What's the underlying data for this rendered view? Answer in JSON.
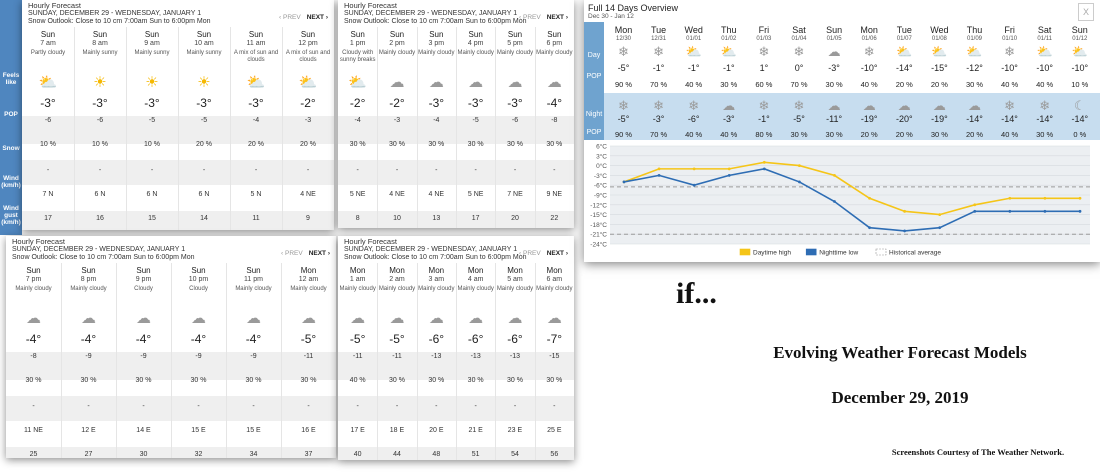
{
  "panels": [
    {
      "title": "Hourly Forecast",
      "dates": "SUNDAY, DECEMBER 29 - WEDNESDAY, JANUARY 1",
      "outlook": "Snow Outlook: Close to 10 cm 7:00am Sun to 6:00pm Mon",
      "prev": "‹ PREV",
      "next": "NEXT ›",
      "row_labels": {
        "feels": "Feels like",
        "pop": "POP",
        "snow": "Snow",
        "wind": "Wind (km/h)",
        "gust": "Wind gust (km/h)"
      },
      "hours": [
        {
          "day": "Sun",
          "hour": "7 am",
          "cond": "Partly cloudy",
          "icon": "partly-cloudy-icon",
          "temp": "-3°",
          "feels": "-6",
          "pop": "10 %",
          "snow": "-",
          "wind": "7 N",
          "gust": "17"
        },
        {
          "day": "Sun",
          "hour": "8 am",
          "cond": "Mainly sunny",
          "icon": "sun-icon",
          "temp": "-3°",
          "feels": "-6",
          "pop": "10 %",
          "snow": "-",
          "wind": "6 N",
          "gust": "16"
        },
        {
          "day": "Sun",
          "hour": "9 am",
          "cond": "Mainly sunny",
          "icon": "sun-icon",
          "temp": "-3°",
          "feels": "-5",
          "pop": "10 %",
          "snow": "-",
          "wind": "6 N",
          "gust": "15"
        },
        {
          "day": "Sun",
          "hour": "10 am",
          "cond": "Mainly sunny",
          "icon": "sun-icon",
          "temp": "-3°",
          "feels": "-5",
          "pop": "20 %",
          "snow": "-",
          "wind": "6 N",
          "gust": "14"
        },
        {
          "day": "Sun",
          "hour": "11 am",
          "cond": "A mix of sun and clouds",
          "icon": "sun-cloud-icon",
          "temp": "-3°",
          "feels": "-4",
          "pop": "20 %",
          "snow": "-",
          "wind": "5 N",
          "gust": "11"
        },
        {
          "day": "Sun",
          "hour": "12 pm",
          "cond": "A mix of sun and clouds",
          "icon": "sun-cloud-icon",
          "temp": "-2°",
          "feels": "-3",
          "pop": "20 %",
          "snow": "-",
          "wind": "4 NE",
          "gust": "9"
        }
      ]
    },
    {
      "title": "Hourly Forecast",
      "dates": "SUNDAY, DECEMBER 29 - WEDNESDAY, JANUARY 1",
      "outlook": "Snow Outlook: Close to 10 cm 7:00am Sun to 6:00pm Mon",
      "prev": "‹ PREV",
      "next": "NEXT ›",
      "hours": [
        {
          "day": "Sun",
          "hour": "1 pm",
          "cond": "Cloudy with sunny breaks",
          "icon": "sun-cloud-icon",
          "temp": "-2°",
          "feels": "-4",
          "pop": "30 %",
          "snow": "-",
          "wind": "5 NE",
          "gust": "8"
        },
        {
          "day": "Sun",
          "hour": "2 pm",
          "cond": "Mainly cloudy",
          "icon": "cloud-icon",
          "temp": "-2°",
          "feels": "-3",
          "pop": "30 %",
          "snow": "-",
          "wind": "4 NE",
          "gust": "10"
        },
        {
          "day": "Sun",
          "hour": "3 pm",
          "cond": "Mainly cloudy",
          "icon": "cloud-icon",
          "temp": "-3°",
          "feels": "-4",
          "pop": "30 %",
          "snow": "-",
          "wind": "4 NE",
          "gust": "13"
        },
        {
          "day": "Sun",
          "hour": "4 pm",
          "cond": "Mainly cloudy",
          "icon": "cloud-icon",
          "temp": "-3°",
          "feels": "-5",
          "pop": "30 %",
          "snow": "-",
          "wind": "5 NE",
          "gust": "17"
        },
        {
          "day": "Sun",
          "hour": "5 pm",
          "cond": "Mainly cloudy",
          "icon": "cloud-icon",
          "temp": "-3°",
          "feels": "-6",
          "pop": "30 %",
          "snow": "-",
          "wind": "7 NE",
          "gust": "20"
        },
        {
          "day": "Sun",
          "hour": "6 pm",
          "cond": "Mainly cloudy",
          "icon": "cloud-icon",
          "temp": "-4°",
          "feels": "-8",
          "pop": "30 %",
          "snow": "-",
          "wind": "9 NE",
          "gust": "22"
        }
      ]
    },
    {
      "title": "Hourly Forecast",
      "dates": "SUNDAY, DECEMBER 29 - WEDNESDAY, JANUARY 1",
      "outlook": "Snow Outlook: Close to 10 cm 7:00am Sun to 6:00pm Mon",
      "prev": "‹ PREV",
      "next": "NEXT ›",
      "hours": [
        {
          "day": "Sun",
          "hour": "7 pm",
          "cond": "Mainly cloudy",
          "icon": "cloud-icon",
          "temp": "-4°",
          "feels": "-8",
          "pop": "30 %",
          "snow": "-",
          "wind": "11 NE",
          "gust": "25"
        },
        {
          "day": "Sun",
          "hour": "8 pm",
          "cond": "Mainly cloudy",
          "icon": "cloud-icon",
          "temp": "-4°",
          "feels": "-9",
          "pop": "30 %",
          "snow": "-",
          "wind": "12 E",
          "gust": "27"
        },
        {
          "day": "Sun",
          "hour": "9 pm",
          "cond": "Cloudy",
          "icon": "cloud-icon",
          "temp": "-4°",
          "feels": "-9",
          "pop": "30 %",
          "snow": "-",
          "wind": "14 E",
          "gust": "30"
        },
        {
          "day": "Sun",
          "hour": "10 pm",
          "cond": "Cloudy",
          "icon": "cloud-icon",
          "temp": "-4°",
          "feels": "-9",
          "pop": "30 %",
          "snow": "-",
          "wind": "15 E",
          "gust": "32"
        },
        {
          "day": "Sun",
          "hour": "11 pm",
          "cond": "Mainly cloudy",
          "icon": "cloud-icon",
          "temp": "-4°",
          "feels": "-9",
          "pop": "30 %",
          "snow": "-",
          "wind": "15 E",
          "gust": "34"
        },
        {
          "day": "Mon",
          "hour": "12 am",
          "cond": "Mainly cloudy",
          "icon": "cloud-icon",
          "temp": "-5°",
          "feels": "-11",
          "pop": "30 %",
          "snow": "-",
          "wind": "16 E",
          "gust": "37"
        }
      ]
    },
    {
      "title": "Hourly Forecast",
      "dates": "SUNDAY, DECEMBER 29 - WEDNESDAY, JANUARY 1",
      "outlook": "Snow Outlook: Close to 10 cm 7:00am Sun to 6:00pm Mon",
      "prev": "‹ PREV",
      "next": "NEXT ›",
      "hours": [
        {
          "day": "Mon",
          "hour": "1 am",
          "cond": "Mainly cloudy",
          "icon": "cloud-icon",
          "temp": "-5°",
          "feels": "-11",
          "pop": "40 %",
          "snow": "-",
          "wind": "17 E",
          "gust": "40"
        },
        {
          "day": "Mon",
          "hour": "2 am",
          "cond": "Mainly cloudy",
          "icon": "cloud-icon",
          "temp": "-5°",
          "feels": "-11",
          "pop": "30 %",
          "snow": "-",
          "wind": "18 E",
          "gust": "44"
        },
        {
          "day": "Mon",
          "hour": "3 am",
          "cond": "Mainly cloudy",
          "icon": "cloud-icon",
          "temp": "-6°",
          "feels": "-13",
          "pop": "30 %",
          "snow": "-",
          "wind": "20 E",
          "gust": "48"
        },
        {
          "day": "Mon",
          "hour": "4 am",
          "cond": "Mainly cloudy",
          "icon": "cloud-icon",
          "temp": "-6°",
          "feels": "-13",
          "pop": "30 %",
          "snow": "-",
          "wind": "21 E",
          "gust": "51"
        },
        {
          "day": "Mon",
          "hour": "5 am",
          "cond": "Mainly cloudy",
          "icon": "cloud-icon",
          "temp": "-6°",
          "feels": "-13",
          "pop": "30 %",
          "snow": "-",
          "wind": "23 E",
          "gust": "54"
        },
        {
          "day": "Mon",
          "hour": "6 am",
          "cond": "Mainly cloudy",
          "icon": "cloud-icon",
          "temp": "-7°",
          "feels": "-15",
          "pop": "30 %",
          "snow": "-",
          "wind": "25 E",
          "gust": "56"
        }
      ]
    }
  ],
  "overview": {
    "title": "Full 14 Days Overview",
    "range": "Dec 30 - Jan 12",
    "close": "X",
    "day_label": "Day",
    "night_label": "Night",
    "pop_label": "POP",
    "days": [
      {
        "name": "Mon",
        "date": "12/30",
        "dtemp": "-5°",
        "dpop": "90 %",
        "ntemp": "-5°",
        "npop": "90 %",
        "dicon": "snow-icon",
        "nicon": "snow-icon"
      },
      {
        "name": "Tue",
        "date": "12/31",
        "dtemp": "-1°",
        "dpop": "70 %",
        "ntemp": "-3°",
        "npop": "70 %",
        "dicon": "snow-icon",
        "nicon": "snow-icon"
      },
      {
        "name": "Wed",
        "date": "01/01",
        "dtemp": "-1°",
        "dpop": "40 %",
        "ntemp": "-6°",
        "npop": "40 %",
        "dicon": "sun-cloud-icon",
        "nicon": "snow-icon"
      },
      {
        "name": "Thu",
        "date": "01/02",
        "dtemp": "-1°",
        "dpop": "30 %",
        "ntemp": "-3°",
        "npop": "40 %",
        "dicon": "sun-cloud-icon",
        "nicon": "cloud-icon"
      },
      {
        "name": "Fri",
        "date": "01/03",
        "dtemp": "1°",
        "dpop": "60 %",
        "ntemp": "-1°",
        "npop": "80 %",
        "dicon": "rain-snow-icon",
        "nicon": "snow-icon"
      },
      {
        "name": "Sat",
        "date": "01/04",
        "dtemp": "0°",
        "dpop": "70 %",
        "ntemp": "-5°",
        "npop": "30 %",
        "dicon": "snow-icon",
        "nicon": "snow-icon"
      },
      {
        "name": "Sun",
        "date": "01/05",
        "dtemp": "-3°",
        "dpop": "30 %",
        "ntemp": "-11°",
        "npop": "30 %",
        "dicon": "cloud-icon",
        "nicon": "cloud-icon"
      },
      {
        "name": "Mon",
        "date": "01/06",
        "dtemp": "-10°",
        "dpop": "40 %",
        "ntemp": "-19°",
        "npop": "20 %",
        "dicon": "snow-icon",
        "nicon": "moon-cloud-icon"
      },
      {
        "name": "Tue",
        "date": "01/07",
        "dtemp": "-14°",
        "dpop": "20 %",
        "ntemp": "-20°",
        "npop": "20 %",
        "dicon": "sun-cloud-icon",
        "nicon": "moon-cloud-icon"
      },
      {
        "name": "Wed",
        "date": "01/08",
        "dtemp": "-15°",
        "dpop": "20 %",
        "ntemp": "-19°",
        "npop": "30 %",
        "dicon": "sun-cloud-icon",
        "nicon": "moon-cloud-icon"
      },
      {
        "name": "Thu",
        "date": "01/09",
        "dtemp": "-12°",
        "dpop": "30 %",
        "ntemp": "-14°",
        "npop": "20 %",
        "dicon": "sun-cloud-icon",
        "nicon": "moon-cloud-icon"
      },
      {
        "name": "Fri",
        "date": "01/10",
        "dtemp": "-10°",
        "dpop": "40 %",
        "ntemp": "-14°",
        "npop": "40 %",
        "dicon": "snow-icon",
        "nicon": "snow-icon"
      },
      {
        "name": "Sat",
        "date": "01/11",
        "dtemp": "-10°",
        "dpop": "40 %",
        "ntemp": "-14°",
        "npop": "30 %",
        "dicon": "sun-snow-icon",
        "nicon": "snow-icon"
      },
      {
        "name": "Sun",
        "date": "01/12",
        "dtemp": "-10°",
        "dpop": "10 %",
        "ntemp": "-14°",
        "npop": "0 %",
        "dicon": "sun-cloud-icon",
        "nicon": "moon-icon"
      }
    ]
  },
  "chart_data": {
    "type": "line",
    "x": [
      "12/30",
      "12/31",
      "01/01",
      "01/02",
      "01/03",
      "01/04",
      "01/05",
      "01/06",
      "01/07",
      "01/08",
      "01/09",
      "01/10",
      "01/11",
      "01/12"
    ],
    "series": [
      {
        "name": "Daytime high",
        "color": "#f5c518",
        "values": [
          -5,
          -1,
          -1,
          -1,
          1,
          0,
          -3,
          -10,
          -14,
          -15,
          -12,
          -10,
          -10,
          -10
        ]
      },
      {
        "name": "Nighttime low",
        "color": "#2e6db4",
        "values": [
          -5,
          -3,
          -6,
          -3,
          -1,
          -5,
          -11,
          -19,
          -20,
          -19,
          -14,
          -14,
          -14,
          -14
        ]
      }
    ],
    "historical_average": {
      "name": "Historical average",
      "values": [
        -6.5,
        -21
      ]
    },
    "ylim": [
      -24,
      6
    ],
    "yticks": [
      "6°C",
      "3°C",
      "0°C",
      "-3°C",
      "-6°C",
      "-9°C",
      "-12°C",
      "-15°C",
      "-18°C",
      "-21°C",
      "-24°C"
    ],
    "legend": "bottom"
  },
  "slide": {
    "if_text": "if...",
    "heading": "Evolving Weather Forecast Models",
    "date": "December 29, 2019",
    "credit": "Screenshots Courtesy of The Weather Network."
  }
}
